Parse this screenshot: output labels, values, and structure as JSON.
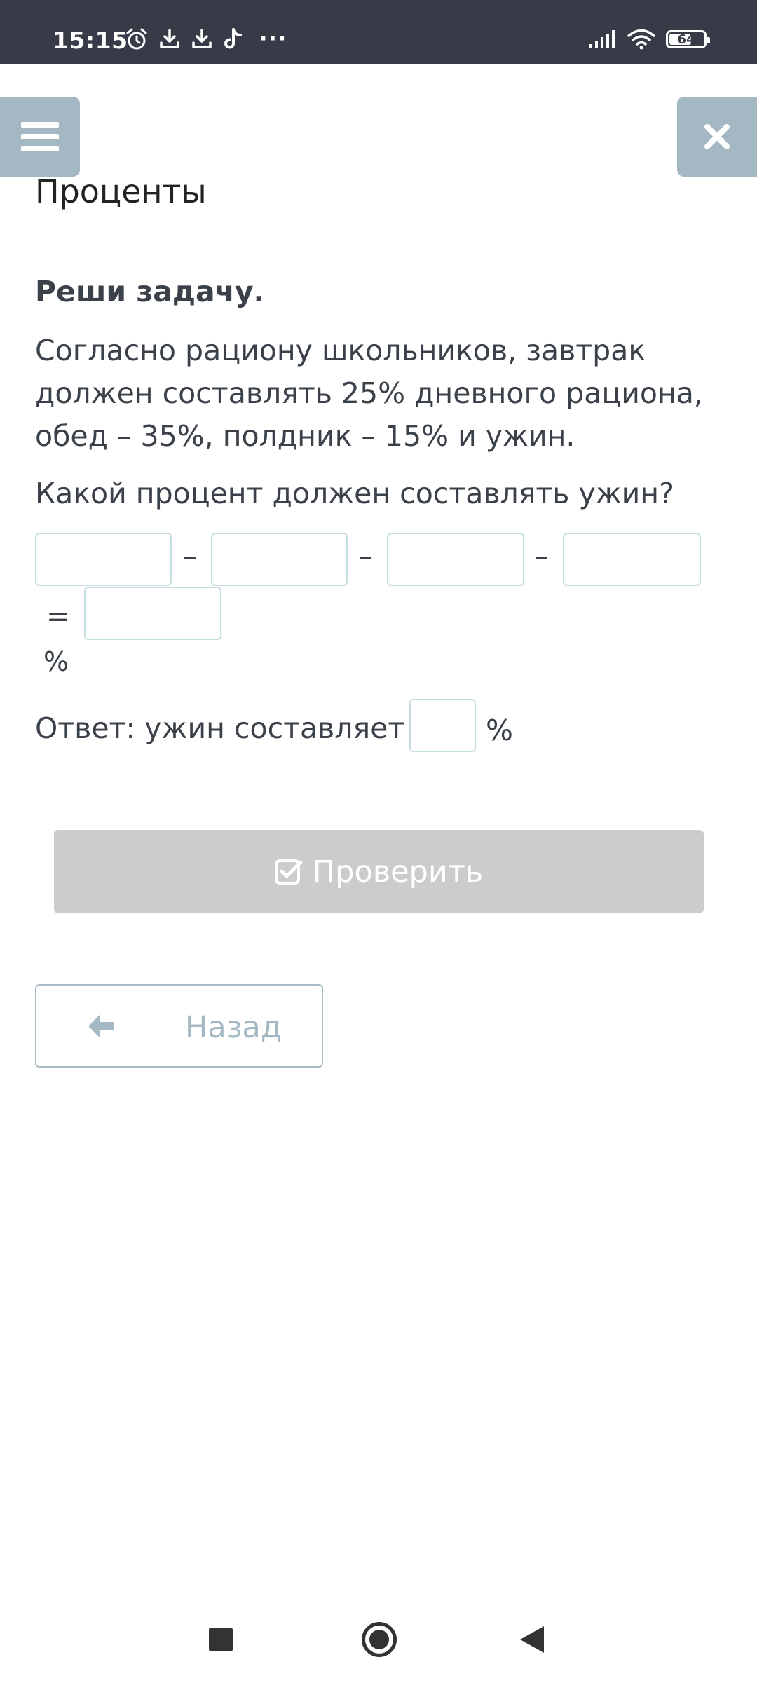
{
  "status_bar": {
    "time": "15:15",
    "notification_icons": [
      "alarm-icon",
      "download-icon",
      "download-icon",
      "tiktok-icon"
    ],
    "more": "···",
    "battery": "64",
    "battery_level": 0.64
  },
  "header": {
    "menu_icon": "hamburger-icon",
    "close_icon": "close-icon"
  },
  "page": {
    "title": "Проценты",
    "task_heading": "Реши задачу.",
    "task_text": "Согласно рациону школьников, завтрак должен составлять 25% дневного рациона, обед – 35%, полдник – 15% и ужин.",
    "question": "Какой процент должен составлять ужин?"
  },
  "equation": {
    "inputs": [
      "",
      "",
      "",
      "",
      ""
    ],
    "minus": "–",
    "equals": "=",
    "unit": "%"
  },
  "answer": {
    "label": "Ответ: ужин составляет",
    "value": "",
    "unit": "%"
  },
  "buttons": {
    "check_label": "Проверить",
    "back_label": "Назад"
  },
  "colors": {
    "status_bar": "#363b47",
    "accent": "#a3b8c3",
    "check_button": "#cccccc",
    "input_border": "#c5dfe0"
  }
}
